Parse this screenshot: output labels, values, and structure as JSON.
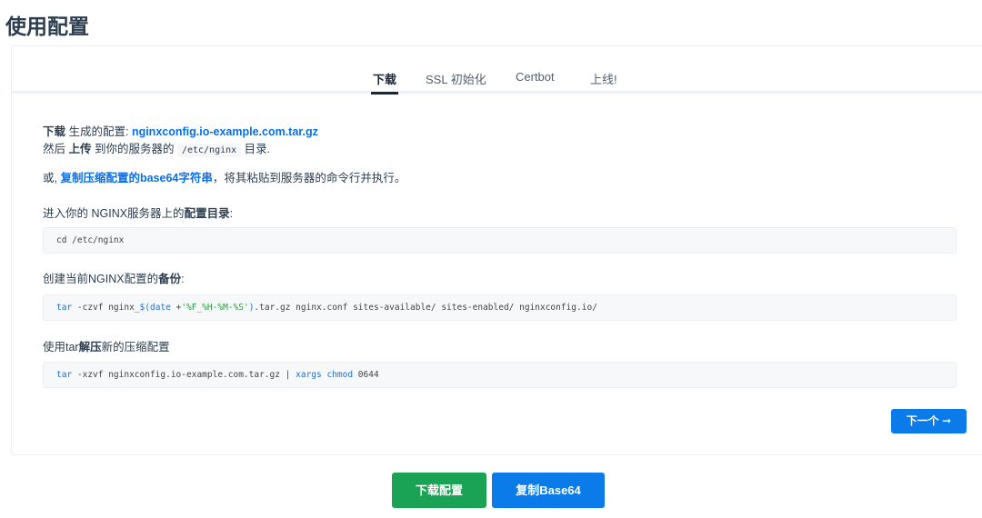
{
  "page": {
    "title": "使用配置"
  },
  "tabs": [
    {
      "label": "下载",
      "active": true
    },
    {
      "label": "SSL 初始化",
      "active": false
    },
    {
      "label": "Certbot",
      "active": false
    },
    {
      "label": "上线!",
      "active": false
    }
  ],
  "download_section": {
    "line1_bold": "下载",
    "line1_text": " 生成的配置: ",
    "line1_link": "nginxconfig.io-example.com.tar.gz",
    "line2_pre": "然后 ",
    "line2_bold": "上传",
    "line2_mid": " 到你的服务器的 ",
    "line2_code": "/etc/nginx",
    "line2_post": " 目录.",
    "line3_pre": "或, ",
    "line3_link": "复制压缩配置的base64字符串",
    "line3_post": "，将其粘贴到服务器的命令行并执行。",
    "step1_text": "进入你的 NGINX服务器上的",
    "step1_bold": "配置目录",
    "step1_post": ":",
    "step1_code": "cd /etc/nginx",
    "step2_text": "创建当前NGINX配置的",
    "step2_bold": "备份",
    "step2_post": ":",
    "step2_code": {
      "cmd": "tar",
      "args1": " -czvf nginx_",
      "sub_open": "$(",
      "sub_cmd": "date",
      "sub_args": " +",
      "sub_str": "'%F_%H-%M-%S'",
      "sub_close": ")",
      "rest": ".tar.gz nginx.conf sites-available/ sites-enabled/ nginxconfig.io/"
    },
    "step3_text": "使用tar",
    "step3_bold": "解压",
    "step3_post": "新的压缩配置",
    "step3_code": {
      "cmd": "tar",
      "args": " -xzvf nginxconfig.io-example.com.tar.gz | ",
      "pipe_cmd1": "xargs",
      "space": " ",
      "pipe_cmd2": "chmod",
      "mode": " 0644"
    }
  },
  "next_button": "下一个 ➞",
  "footer": {
    "download_label": "下载配置",
    "copy_label": "复制Base64"
  },
  "colors": {
    "accent_blue": "#0a7be9",
    "accent_green": "#1aa354",
    "link_blue": "#0a6ee6",
    "code_keyword": "#1f70d6",
    "code_string": "#2b9a43"
  }
}
